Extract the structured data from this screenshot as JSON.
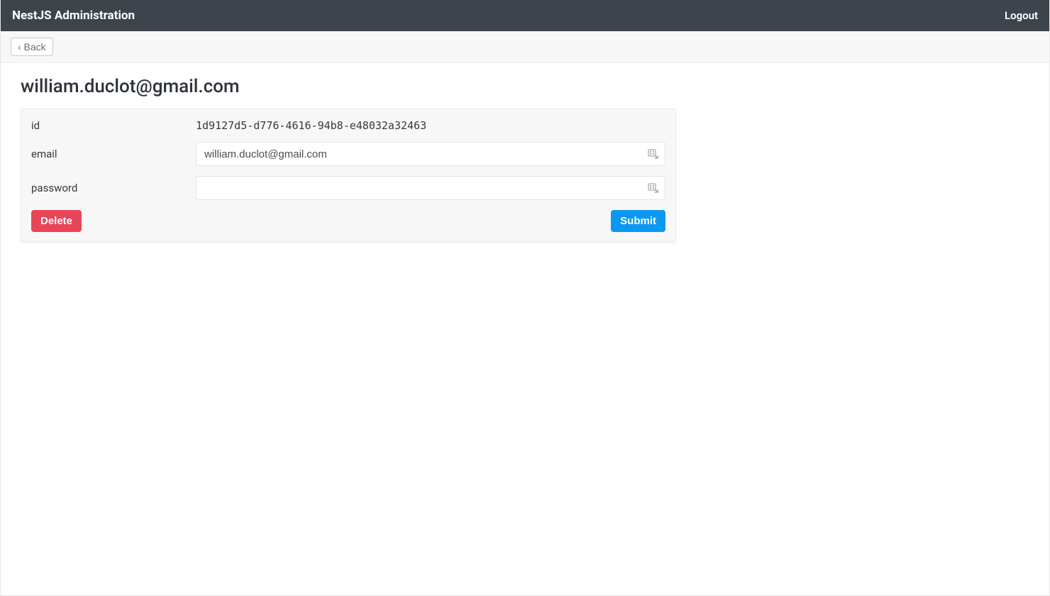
{
  "navbar": {
    "brand": "NestJS Administration",
    "logout_label": "Logout"
  },
  "subbar": {
    "back_label": "‹ Back"
  },
  "page": {
    "title": "william.duclot@gmail.com"
  },
  "form": {
    "id_label": "id",
    "id_value": "1d9127d5-d776-4616-94b8-e48032a32463",
    "email_label": "email",
    "email_value": "william.duclot@gmail.com",
    "password_label": "password",
    "password_value": ""
  },
  "actions": {
    "delete_label": "Delete",
    "submit_label": "Submit"
  },
  "colors": {
    "navbar_bg": "#3e444c",
    "delete_bg": "#e64657",
    "submit_bg": "#0b98f0"
  }
}
